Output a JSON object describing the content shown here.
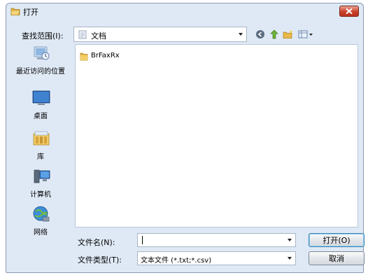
{
  "window": {
    "title": "打开"
  },
  "lookin": {
    "label": "查找范围(I):",
    "value": "文档"
  },
  "places": [
    {
      "label": "最近访问的位置",
      "icon": "recent-places-icon"
    },
    {
      "label": "桌面",
      "icon": "desktop-icon"
    },
    {
      "label": "库",
      "icon": "libraries-icon"
    },
    {
      "label": "计算机",
      "icon": "computer-icon"
    },
    {
      "label": "网络",
      "icon": "network-icon"
    }
  ],
  "files": [
    {
      "name": "BrFaxRx",
      "icon": "folder-icon"
    }
  ],
  "filename": {
    "label": "文件名(N):",
    "value": "",
    "placeholder": ""
  },
  "filetype": {
    "label": "文件类型(T):",
    "value": "文本文件 (*.txt;*.csv)"
  },
  "buttons": {
    "open": "打开(O)",
    "cancel": "取消"
  },
  "colors": {
    "window_bg": "#dfe9f5",
    "close_button": "#c9402a",
    "default_button_border": "#3c7fb1"
  }
}
